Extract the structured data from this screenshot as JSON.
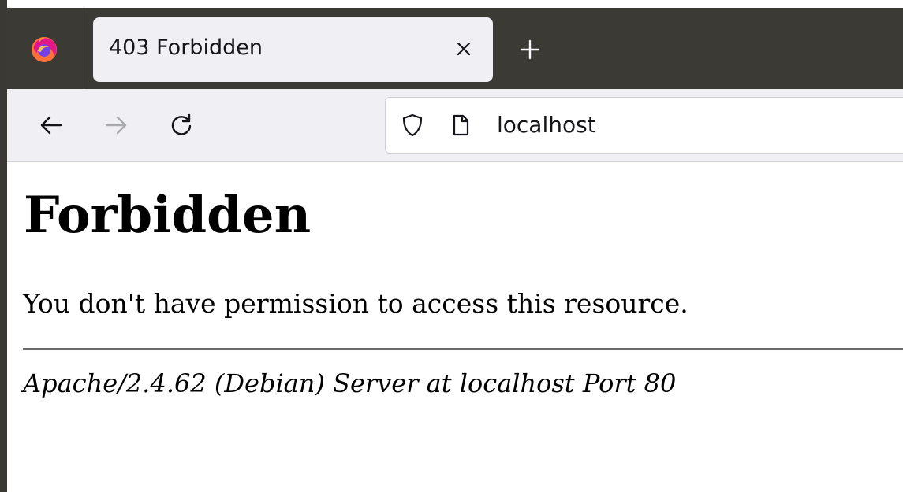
{
  "browser": {
    "tab": {
      "title": "403 Forbidden",
      "close_icon": "close-icon"
    },
    "new_tab_icon": "plus-icon",
    "logo_icon": "firefox-logo-icon",
    "nav": {
      "back_icon": "back-arrow-icon",
      "forward_icon": "forward-arrow-icon",
      "reload_icon": "reload-icon"
    },
    "urlbar": {
      "shield_icon": "tracking-protection-shield-icon",
      "page_icon": "page-icon",
      "url": "localhost"
    },
    "colors": {
      "tabbar_bg": "#3b3a35",
      "toolbar_bg": "#f0f0f4",
      "selected_tab_bg": "#f0f0f4"
    }
  },
  "page": {
    "heading": "Forbidden",
    "message": "You don't have permission to access this resource.",
    "signature": "Apache/2.4.62 (Debian) Server at localhost Port 80"
  }
}
